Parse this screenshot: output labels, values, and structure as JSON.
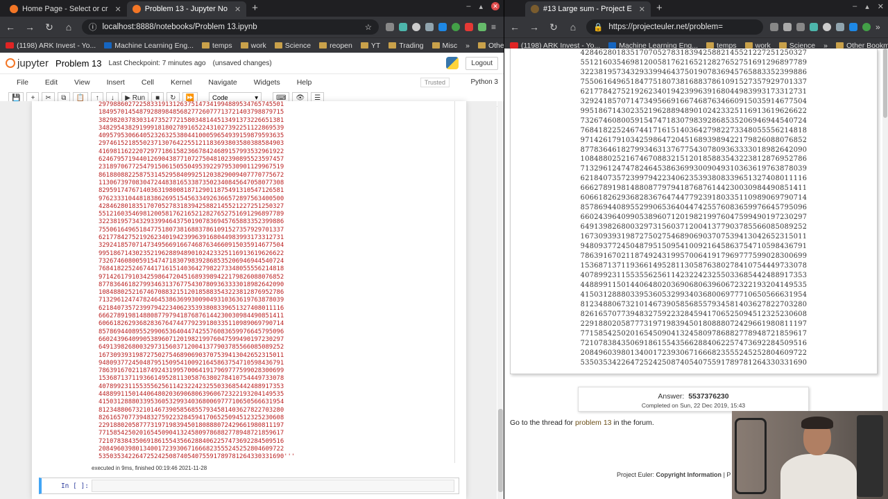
{
  "left_window": {
    "tabs": [
      {
        "label": "Home Page - Select or cr",
        "active": false
      },
      {
        "label": "Problem 13 - Jupyter No",
        "active": true
      }
    ],
    "url": "localhost:8888/notebooks/Problem 13.ipynb",
    "bookmarks": [
      "(1198) ARK Invest - Yo...",
      "Machine Learning Eng...",
      "temps",
      "work",
      "Science",
      "reopen",
      "YT",
      "Trading",
      "Misc",
      "Other Bookmarks"
    ]
  },
  "jupyter": {
    "logo": "jupyter",
    "notebook_name": "Problem 13",
    "checkpoint": "Last Checkpoint: 7 minutes ago",
    "unsaved": "(unsaved changes)",
    "logout": "Logout",
    "menu": [
      "File",
      "Edit",
      "View",
      "Insert",
      "Cell",
      "Kernel",
      "Navigate",
      "Widgets",
      "Help"
    ],
    "trusted": "Trusted",
    "kernel": "Python 3",
    "run_label": "Run",
    "cell_type": "Code",
    "executed": "executed in 9ms, finished 00:19:46 2021-11-28",
    "prompt": "In [ ]:",
    "output_lines": [
      "29798860272258331913126375147341994889534765745501",
      "18495701454879288984856827726077713721403798879715",
      "38298203783031473527721580348144513491373226651381",
      "34829543829199918180278916522431027392251122869539",
      "40957953066405232632538044100059654939159879593635",
      "29746152185502371307642255121183693803580388584903",
      "41698116222072977186158236678424689157993532961922",
      "62467957194401269043877107275048102390895523597457",
      "23189706772547915061505504953922979530901129967519",
      "86188088225875314529584099251203829009407770775672",
      "11306739708304724483816533873502340845647058077308",
      "82959174767140363198008187129011875491310547126581",
      "97623331044818386269515456334926366572897563400500",
      "42846280183517070527831839425882145521227251250327",
      "55121603546981200581762165212827652751691296897789",
      "32238195734329339946437501907836945765883352399886",
      "75506164965184775180738168837861091527357929701337",
      "62177842752192623401942399639168044983993173312731",
      "32924185707147349566916674687634660915035914677504",
      "99518671430235219628894890102423325116913619626622",
      "73267460800591547471830798392868535206946944540724",
      "76841822524674417161514036427982273348055556214818",
      "97142617910342598647204516893989422179826088076852",
      "87783646182799346313767754307809363333018982642090",
      "10848802521674670883215120185883543223812876952786",
      "71329612474782464538636993009049310363619763878039",
      "62184073572399794223406235393808339651327408011116",
      "66627891981488087797941876876144230030984490851411",
      "60661826293682836764744779239180335110989069790714",
      "85786944089552990653640447425576083659976645795096",
      "66024396409905389607120198219976047599490197230297",
      "64913982680032973156037120041377903785566085089252",
      "16730939319872750275468906903707539413042652315011",
      "94809377245048795150954100921645863754710598436791",
      "78639167021187492431995700641917969777599028300699",
      "15368713711936614952811305876380278410754449733078",
      "40789923115535562561142322423255033685442488917353",
      "44889911501440648020369068063960672322193204149535",
      "41503128880339536053299340368006977710650566631954",
      "81234880673210146739058568557934581403627822703280",
      "82616570773948327592232845941706525094512325230608",
      "22918802058777319719839450180888072429661980811197",
      "77158542502016545090413245809786882778948721859617",
      "72107838435069186155435662884062257473692284509516",
      "20849603980134001723930671666823555245252804609722",
      "53503534226472524250874054075591789781264330331690'''"
    ]
  },
  "right_window": {
    "tabs": [
      {
        "label": "#13 Large sum - Project E",
        "active": true
      }
    ],
    "url": "https://projecteuler.net/problem=",
    "bookmarks": [
      "(1198) ARK Invest - Yo...",
      "Machine Learning Eng...",
      "temps",
      "work",
      "Science",
      "Other Bookmarks"
    ],
    "number_lines": [
      "42846280183517070527831839425882145521227251250327",
      "55121603546981200581762165212827652751691296897789",
      "32238195734329339946437501907836945765883352399886",
      "75506164965184775180738168837861091527357929701337",
      "62177842752192623401942399639168044983993173312731",
      "32924185707147349566916674687634660915035914677504",
      "99518671430235219628894890102423325116913619626622",
      "73267460800591547471830798392868535206946944540724",
      "76841822524674417161514036427982273348055556214818",
      "97142617910342598647204516893989422179826088076852",
      "87783646182799346313767754307809363333018982642090",
      "10848802521674670883215120185883543223812876952786",
      "71329612474782464538636993009049310363619763878039",
      "62184073572399794223406235393808339651327408011116",
      "66627891981488087797941876876144230030984490851411",
      "60661826293682836764744779239180335110989069790714",
      "85786944089552990653640447425576083659976645795096",
      "66024396409905389607120198219976047599490197230297",
      "64913982680032973156037120041377903785566085089252",
      "16730939319872750275468906903707539413042652315011",
      "94809377245048795150954100921645863754710598436791",
      "78639167021187492431995700641917969777599028300699",
      "15368713711936614952811305876380278410754449733078",
      "40789923115535562561142322423255033685442488917353",
      "44889911501440648020369068063960672322193204149535",
      "41503128880339536053299340368006977710650566631954",
      "81234880673210146739058568557934581403627822703280",
      "82616570773948327592232845941706525094512325230608",
      "22918802058777319719839450180888072429661980811197",
      "77158542502016545090413245809786882778948721859617",
      "72107838435069186155435662884062257473692284509516",
      "20849603980134001723930671666823555245252804609722",
      "53503534226472524250874054075591789781264330331690"
    ],
    "answer_label": "Answer:",
    "answer_value": "5537376230",
    "completed": "Completed on Sun, 22 Dec 2019, 15:43",
    "thread_prefix": "Go to the thread for",
    "thread_link": "problem 13",
    "thread_suffix": "in the forum.",
    "footer_prefix": "Project Euler:",
    "footer_link": "Copyright Information",
    "footer_sep": "| P"
  },
  "colors": {
    "output_red": "#ba2121",
    "chrome_dark": "#35363a",
    "jupyter_orange": "#f37626",
    "link_brown": "#6b4e16"
  }
}
